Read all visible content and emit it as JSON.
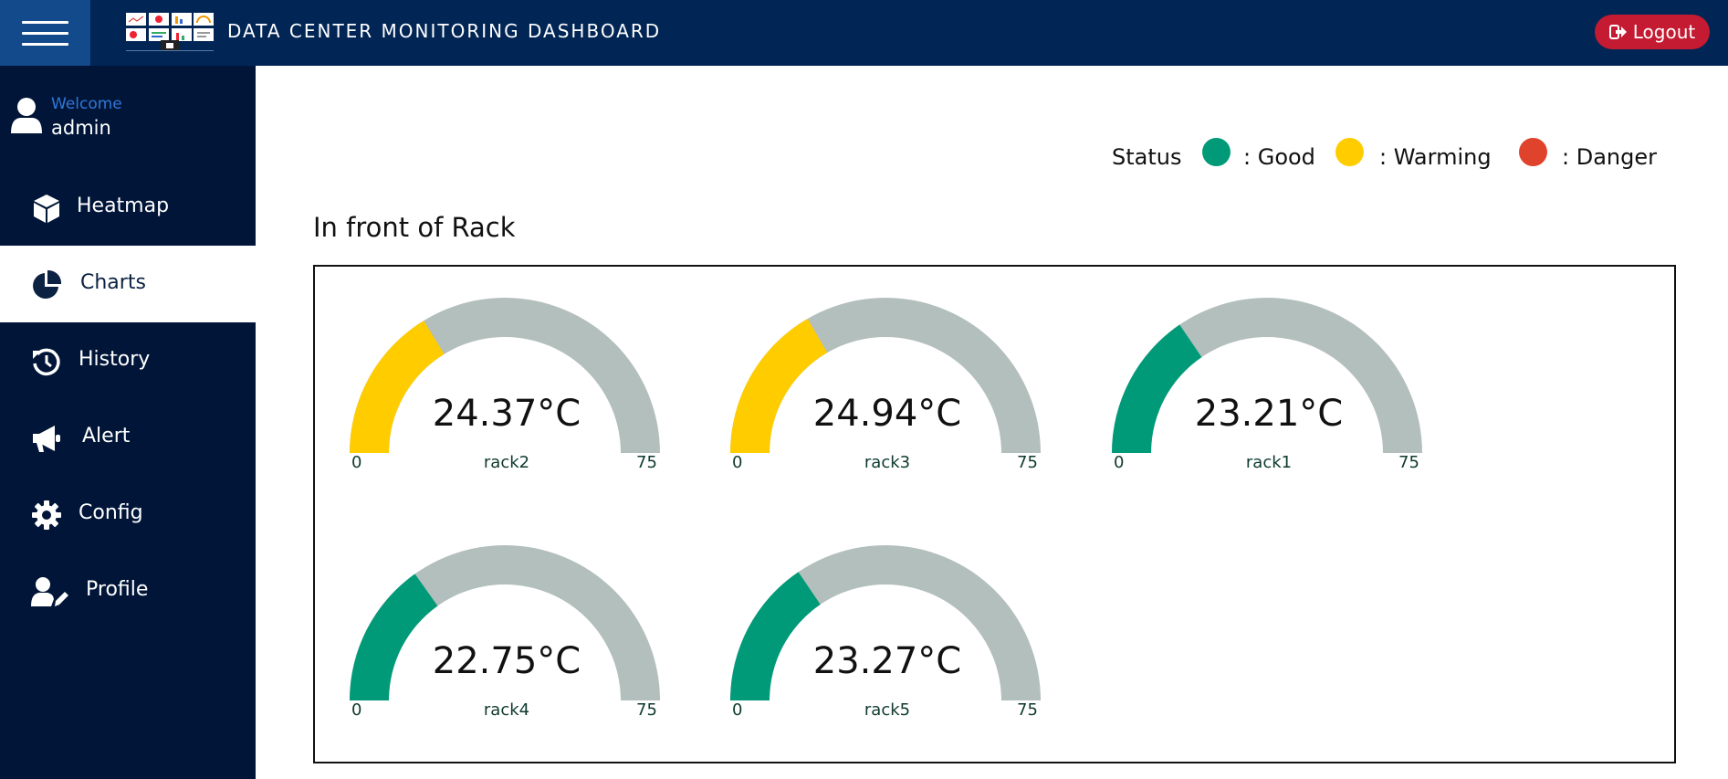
{
  "header": {
    "title": "DATA CENTER MONITORING DASHBOARD",
    "logout_label": "Logout"
  },
  "user": {
    "welcome": "Welcome",
    "name": "admin"
  },
  "sidebar": {
    "items": [
      {
        "label": "Heatmap",
        "icon": "cube-icon"
      },
      {
        "label": "Charts",
        "icon": "pie-chart-icon",
        "active": true
      },
      {
        "label": "History",
        "icon": "history-icon"
      },
      {
        "label": "Alert",
        "icon": "megaphone-icon"
      },
      {
        "label": "Config",
        "icon": "gear-icon"
      },
      {
        "label": "Profile",
        "icon": "user-edit-icon"
      }
    ]
  },
  "legend": {
    "title": "Status",
    "items": [
      {
        "label": ": Good",
        "color": "#009a78"
      },
      {
        "label": ": Warming",
        "color": "#ffcc00"
      },
      {
        "label": ": Danger",
        "color": "#e0432b"
      }
    ]
  },
  "section": {
    "title": "In front of Rack"
  },
  "gauges": [
    {
      "label": "rack2",
      "value_text": "24.37°C",
      "value": 24.37,
      "min": "0",
      "max": "75",
      "color": "#ffcc00"
    },
    {
      "label": "rack3",
      "value_text": "24.94°C",
      "value": 24.94,
      "min": "0",
      "max": "75",
      "color": "#ffcc00"
    },
    {
      "label": "rack1",
      "value_text": "23.21°C",
      "value": 23.21,
      "min": "0",
      "max": "75",
      "color": "#009a78"
    },
    {
      "label": "rack4",
      "value_text": "22.75°C",
      "value": 22.75,
      "min": "0",
      "max": "75",
      "color": "#009a78"
    },
    {
      "label": "rack5",
      "value_text": "23.27°C",
      "value": 23.27,
      "min": "0",
      "max": "75",
      "color": "#009a78"
    }
  ],
  "colors": {
    "gauge_track": "#b3bfbc",
    "header_bg": "#012554",
    "sidebar_bg": "#001538",
    "logout_bg": "#c41a32"
  }
}
